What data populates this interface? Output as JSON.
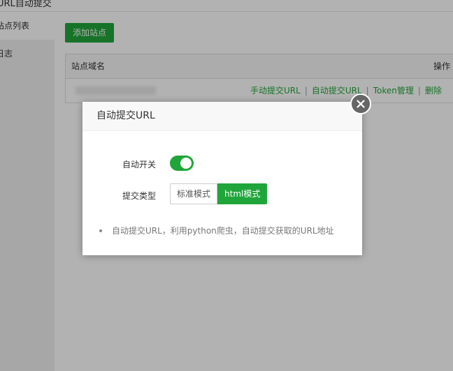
{
  "window": {
    "title": "URL自动提交"
  },
  "sidebar": {
    "items": [
      {
        "label": "站点列表"
      },
      {
        "label": "日志"
      }
    ]
  },
  "toolbar": {
    "add_site_label": "添加站点"
  },
  "table": {
    "columns": [
      "站点域名",
      "操作"
    ],
    "rows": [
      {
        "domain": "",
        "actions": [
          "手动提交URL",
          "自动提交URL",
          "Token管理",
          "删除"
        ]
      }
    ]
  },
  "dialog": {
    "title": "自动提交URL",
    "auto_switch_label": "自动开关",
    "auto_switch_on": true,
    "submit_type_label": "提交类型",
    "submit_type_options": [
      "标准模式",
      "html模式"
    ],
    "submit_type_selected": "html模式",
    "note": "自动提交URL，利用python爬虫，自动提交获取的URL地址"
  },
  "colors": {
    "accent": "#20a53a",
    "overlay": "rgba(0,0,0,0.3)"
  }
}
